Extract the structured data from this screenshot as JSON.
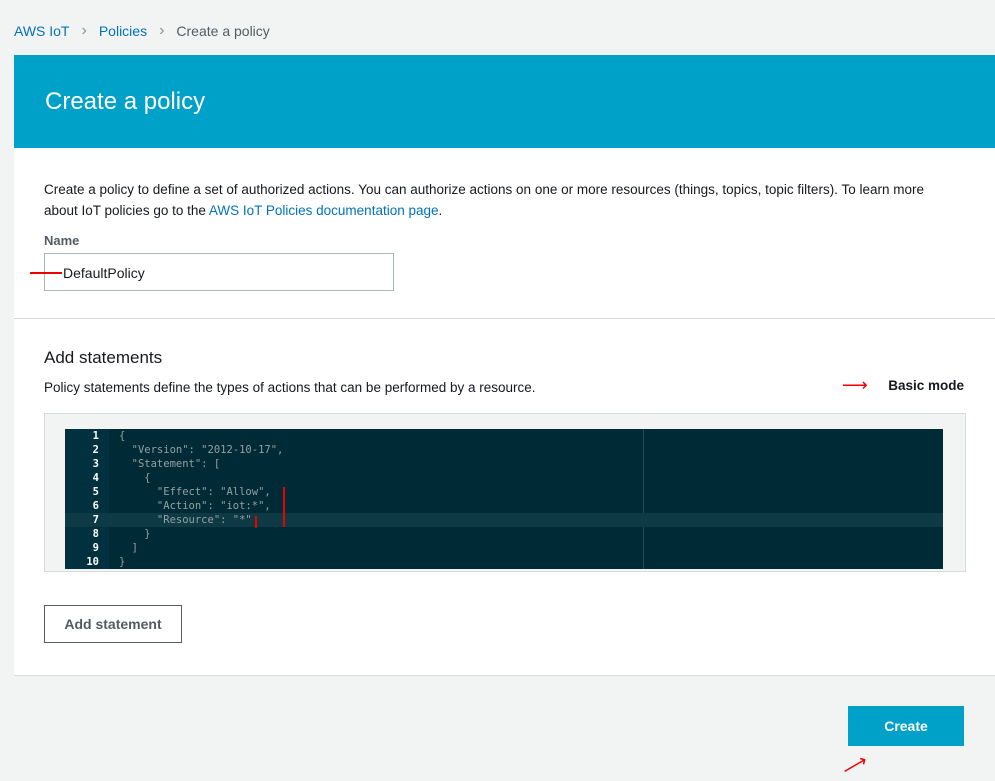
{
  "breadcrumb": [
    "AWS IoT",
    "Policies",
    "Create a policy"
  ],
  "header": {
    "title": "Create a policy"
  },
  "intro": {
    "text": "Create a policy to define a set of authorized actions. You can authorize actions on one or more resources (things, topics, topic filters). To learn more about IoT policies go to the ",
    "link": "AWS IoT Policies documentation page",
    "end": "."
  },
  "name": {
    "label": "Name",
    "value": "DefaultPolicy"
  },
  "statements": {
    "title": "Add statements",
    "description": "Policy statements define the types of actions that can be performed by a resource.",
    "mode_link": "Basic mode"
  },
  "editor": {
    "lines": [
      "{",
      "  \"Version\": \"2012-10-17\",",
      "  \"Statement\": [",
      "    {",
      "      \"Effect\": \"Allow\",",
      "      \"Action\": \"iot:*\",",
      "      \"Resource\": \"*\"",
      "    }",
      "  ]",
      "}"
    ],
    "active_line": 7
  },
  "buttons": {
    "add_statement": "Add statement",
    "create": "Create"
  }
}
